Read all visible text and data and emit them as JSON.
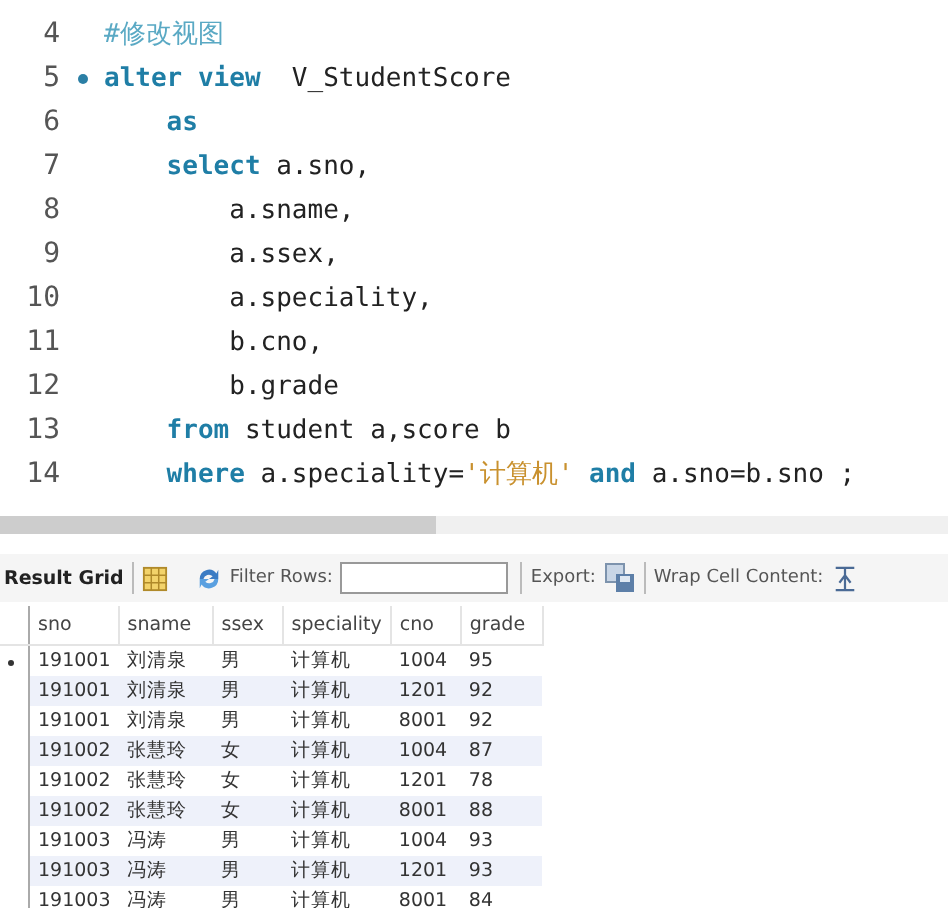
{
  "editor": {
    "lines": [
      {
        "number": "4",
        "marked": false,
        "tokens": [
          {
            "kind": "comment",
            "text": "#修改视图"
          }
        ]
      },
      {
        "number": "5",
        "marked": true,
        "tokens": [
          {
            "kind": "keyword",
            "text": "alter view"
          },
          {
            "kind": "plain",
            "text": "  V_StudentScore"
          }
        ]
      },
      {
        "number": "6",
        "marked": false,
        "tokens": [
          {
            "kind": "keyword",
            "text": "    as"
          }
        ]
      },
      {
        "number": "7",
        "marked": false,
        "tokens": [
          {
            "kind": "keyword",
            "text": "    select"
          },
          {
            "kind": "plain",
            "text": " a.sno,"
          }
        ]
      },
      {
        "number": "8",
        "marked": false,
        "tokens": [
          {
            "kind": "plain",
            "text": "        a.sname,"
          }
        ]
      },
      {
        "number": "9",
        "marked": false,
        "tokens": [
          {
            "kind": "plain",
            "text": "        a.ssex,"
          }
        ]
      },
      {
        "number": "10",
        "marked": false,
        "tokens": [
          {
            "kind": "plain",
            "text": "        a.speciality,"
          }
        ]
      },
      {
        "number": "11",
        "marked": false,
        "tokens": [
          {
            "kind": "plain",
            "text": "        b.cno,"
          }
        ]
      },
      {
        "number": "12",
        "marked": false,
        "tokens": [
          {
            "kind": "plain",
            "text": "        b.grade"
          }
        ]
      },
      {
        "number": "13",
        "marked": false,
        "tokens": [
          {
            "kind": "keyword",
            "text": "    from"
          },
          {
            "kind": "plain",
            "text": " student a,score b"
          }
        ]
      },
      {
        "number": "14",
        "marked": false,
        "tokens": [
          {
            "kind": "keyword",
            "text": "    where"
          },
          {
            "kind": "plain",
            "text": " a.speciality="
          },
          {
            "kind": "string",
            "text": "'计算机'"
          },
          {
            "kind": "keyword",
            "text": " and"
          },
          {
            "kind": "plain",
            "text": " a.sno=b.sno ;"
          }
        ]
      }
    ]
  },
  "toolbar": {
    "title": "Result Grid",
    "filter_label": "Filter Rows:",
    "export_label": "Export:",
    "wrap_label": "Wrap Cell Content:"
  },
  "table": {
    "columns": [
      "sno",
      "sname",
      "ssex",
      "speciality",
      "cno",
      "grade"
    ],
    "rows": [
      {
        "current": true,
        "cells": [
          "191001",
          "刘清泉",
          "男",
          "计算机",
          "1004",
          "95"
        ]
      },
      {
        "current": false,
        "cells": [
          "191001",
          "刘清泉",
          "男",
          "计算机",
          "1201",
          "92"
        ]
      },
      {
        "current": false,
        "cells": [
          "191001",
          "刘清泉",
          "男",
          "计算机",
          "8001",
          "92"
        ]
      },
      {
        "current": false,
        "cells": [
          "191002",
          "张慧玲",
          "女",
          "计算机",
          "1004",
          "87"
        ]
      },
      {
        "current": false,
        "cells": [
          "191002",
          "张慧玲",
          "女",
          "计算机",
          "1201",
          "78"
        ]
      },
      {
        "current": false,
        "cells": [
          "191002",
          "张慧玲",
          "女",
          "计算机",
          "8001",
          "88"
        ]
      },
      {
        "current": false,
        "cells": [
          "191003",
          "冯涛",
          "男",
          "计算机",
          "1004",
          "93"
        ]
      },
      {
        "current": false,
        "cells": [
          "191003",
          "冯涛",
          "男",
          "计算机",
          "1201",
          "93"
        ]
      },
      {
        "current": false,
        "cells": [
          "191003",
          "冯涛",
          "男",
          "计算机",
          "8001",
          "84"
        ]
      }
    ]
  }
}
